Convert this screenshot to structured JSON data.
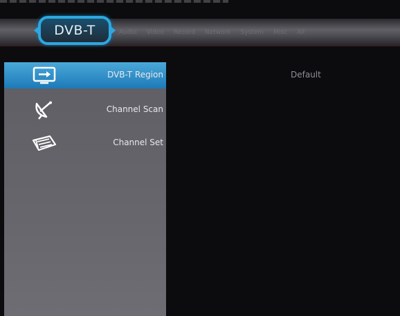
{
  "header": {
    "active_tab": "DVB-T",
    "tabs": [
      "Audio",
      "Video",
      "Record",
      "Network",
      "System",
      "Misc",
      "All"
    ]
  },
  "menu": {
    "items": [
      {
        "label": "DVB-T Region",
        "icon": "tv-input-icon",
        "selected": true
      },
      {
        "label": "Channel Scan",
        "icon": "satellite-dish-icon",
        "selected": false
      },
      {
        "label": "Channel Set",
        "icon": "channel-list-icon",
        "selected": false
      }
    ]
  },
  "content": {
    "region_value": "Default"
  },
  "colors": {
    "accent": "#2da8df",
    "selected_item": "#1e7ab8"
  }
}
